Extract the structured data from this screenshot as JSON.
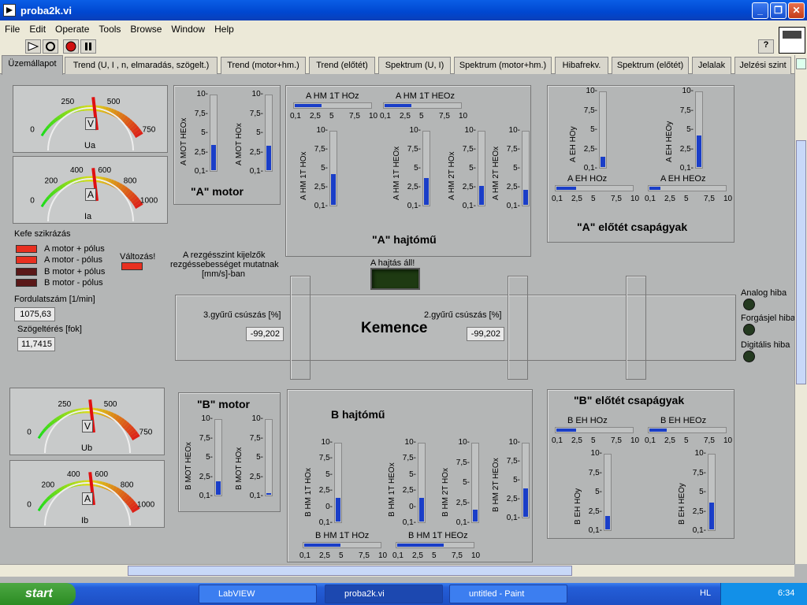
{
  "window": {
    "title": "proba2k.vi"
  },
  "menu": [
    "File",
    "Edit",
    "Operate",
    "Tools",
    "Browse",
    "Window",
    "Help"
  ],
  "tabs": [
    "Üzemállapot",
    "Trend (U, I , n, elmaradás, szögelt.)",
    "Trend (motor+hm.)",
    "Trend (előtét)",
    "Spektrum (U, I)",
    "Spektrum (motor+hm.)",
    "Hibafrekv.",
    "Spektrum (előtét)",
    "Jelalak",
    "Jelzési szint"
  ],
  "gauges": {
    "ua": {
      "label": "Ua",
      "unit": "V",
      "ticks": [
        "0",
        "250",
        "500",
        "750"
      ],
      "value_fraction": 0.44
    },
    "ia": {
      "label": "Ia",
      "unit": "A",
      "ticks": [
        "0",
        "200",
        "400",
        "600",
        "800",
        "1000"
      ],
      "value_fraction": 0.44
    },
    "ub": {
      "label": "Ub",
      "unit": "V",
      "ticks": [
        "0",
        "250",
        "500",
        "750"
      ],
      "value_fraction": 0.44
    },
    "ib": {
      "label": "Ib",
      "unit": "A",
      "ticks": [
        "0",
        "200",
        "400",
        "600",
        "800",
        "1000"
      ],
      "value_fraction": 0.44
    }
  },
  "vticks": [
    "10-",
    "7,5-",
    "5-",
    "2,5-",
    "0,1-"
  ],
  "vticks_b": [
    "10-",
    "7,5-",
    "5-",
    "2,5-",
    "0-",
    "0,1-"
  ],
  "hticks": [
    "0,1",
    "2,5",
    "5",
    "7,5",
    "10"
  ],
  "a_motor": {
    "title": "\"A\" motor",
    "s1": "A MOT HEOx",
    "s2": "A MOT HOx",
    "v1": 0.33,
    "v2": 0.32
  },
  "a_hajtomu": {
    "title": "\"A\" hajtómű",
    "h1": "A HM 1T HOz",
    "h2": "A HM 1T HEOz",
    "hv1": 0.35,
    "hv2": 0.35,
    "s1": "A HM 1T HOx",
    "s2": "A HM 1T HEOx",
    "s3": "A HM 2T HOx",
    "s4": "A HM 2T HEOx",
    "v1": 0.42,
    "v2": 0.36,
    "v3": 0.26,
    "v4": 0.2
  },
  "a_elotet": {
    "title": "\"A\" előtét csapágyak",
    "s1": "A EH HOy",
    "s2": "A EH HEOy",
    "v1": 0.14,
    "v2": 0.42,
    "h1": "A EH HOz",
    "h2": "A EH HEOz",
    "hv1": 0.25,
    "hv2": 0.14
  },
  "kefe": {
    "title": "Kefe szikrázás",
    "items": [
      "A motor + pólus",
      "A motor - pólus",
      "B motor + pólus",
      "B motor - pólus"
    ],
    "valtozas": "Változás!"
  },
  "fordulat": {
    "label": "Fordulatszám [1/min]",
    "value": "1075,63"
  },
  "szog": {
    "label": "Szögeltérés [fok]",
    "value": "11,7415"
  },
  "note": {
    "l1": "A rezgésszint kijelzők",
    "l2": "rezgéssebességet mutatnak",
    "l3": "[mm/s]-ban"
  },
  "hajtas": {
    "label": "A hajtás áll!"
  },
  "kemence": {
    "title": "Kemence",
    "g3": "3.gyűrű csúszás [%]",
    "g3v": "-99,202",
    "g2": "2.gyűrű csúszás [%]",
    "g2v": "-99,202"
  },
  "errors": [
    "Analog hiba",
    "Forgásjel hiba",
    "Digitális hiba"
  ],
  "b_motor": {
    "title": "\"B\" motor",
    "s1": "B MOT HEOx",
    "s2": "B MOT HOx",
    "v1": 0.18,
    "v2": 0.02
  },
  "b_hajtomu": {
    "title": "B hajtómű",
    "s1": "B HM 1T HOx",
    "s2": "B HM 1T HEOx",
    "s3": "B HM 2T HOx",
    "s4": "B HM 2T HEOx",
    "v1": 0.3,
    "v2": 0.3,
    "v3": 0.15,
    "v4": 0.38,
    "h1": "B HM 1T HOz",
    "h2": "B HM 1T HEOz",
    "hv1": 0.47,
    "hv2": 0.6
  },
  "b_elotet": {
    "title": "\"B\" előtét csapágyak",
    "h1": "B EH HOz",
    "h2": "B EH HEOz",
    "hv1": 0.25,
    "hv2": 0.22,
    "s1": "B EH HOy",
    "s2": "B EH HEOy",
    "v1": 0.18,
    "v2": 0.35
  },
  "taskbar": {
    "start": "start",
    "tasks": [
      "LabVIEW",
      "proba2k.vi",
      "untitled - Paint"
    ],
    "lang": "HL",
    "clock": "6:34"
  }
}
